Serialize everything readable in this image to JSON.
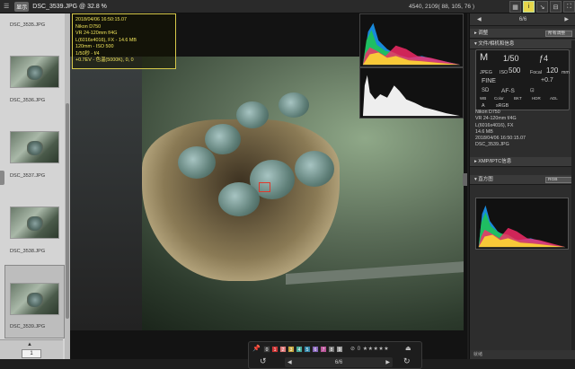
{
  "topbar": {
    "menu": "☰",
    "badge": "显示",
    "file_title": "DSC_3539.JPG @ 32.8 %",
    "pixel_info": "4540, 2109( 88, 105, 76 )",
    "buttons": [
      "▦",
      "i",
      "↘",
      "⊟",
      "⛶"
    ]
  },
  "filmstrip": {
    "items": [
      {
        "label": "DSC_3535.JPG"
      },
      {
        "label": "DSC_3536.JPG"
      },
      {
        "label": "DSC_3537.JPG"
      },
      {
        "label": "DSC_3538.JPG"
      },
      {
        "label": "DSC_3539.JPG"
      }
    ],
    "page_number": "1",
    "up_arrow": "▲"
  },
  "shooting_info": {
    "line1": "2018/04/06 16:50:15.07",
    "line2": "Nikon D750",
    "line3": "VR 24-120mm f/4G",
    "line4": "L(6016x4016), FX - 14.6 MB",
    "line5": "120mm - ISO 500",
    "line6": "1/50秒 - f/4",
    "line7": "+0.7EV - 色温(5000K), 0, 0"
  },
  "palette": {
    "pin": "📌",
    "labels": [
      "0",
      "1",
      "2",
      "3",
      "4",
      "5",
      "6",
      "7",
      "8",
      "9"
    ],
    "label_colors": [
      "#444",
      "#c33",
      "#d77",
      "#c8a63a",
      "#4a9",
      "#38a",
      "#86b",
      "#b59",
      "#777",
      "#999"
    ],
    "rating_prefix": "⊘ 0",
    "rating_stars": "★★★★★",
    "nav_prev": "◀",
    "nav_count": "6/6",
    "nav_next": "▶",
    "rotate_left": "↺",
    "rotate_right": "↻",
    "eject": "⏏"
  },
  "right_panel": {
    "page_count": "6/6",
    "nav_prev": "◀",
    "nav_next": "▶",
    "adjust_header": "▸ 调整",
    "adjust_select": "所有调整",
    "fileinfo_header": "▾ 文件/相机和信息",
    "cam": {
      "mode": "M",
      "shutter": "1/50",
      "fstop": "ƒ4",
      "iso_label": "ISO",
      "iso": "500",
      "focal_label": "Focal",
      "focal": "120",
      "focal_unit": "mm",
      "format": "JPEG",
      "quality": "FINE",
      "ev": "+0.7",
      "af": "AF-S",
      "wb": "WB",
      "color": "Color",
      "bkt": "BKT",
      "hdr": "HDR",
      "adl": "ADL",
      "colorspace": "sRGB",
      "wb_auto": "A",
      "picture_ctrl": "SD",
      "meter": "⊡"
    },
    "meta": [
      "Nikon D750",
      "VR 24-120mm f/4G",
      "L(6016x4016), FX",
      "14.6 MB",
      "2018/04/06 16:50:15.07",
      "DSC_3539.JPG"
    ],
    "xmp_header": "▸ XMP/IPTC信息",
    "hist_header": "▾ 直方图",
    "hist_select": "RGB",
    "bottom_label": "就绪"
  }
}
